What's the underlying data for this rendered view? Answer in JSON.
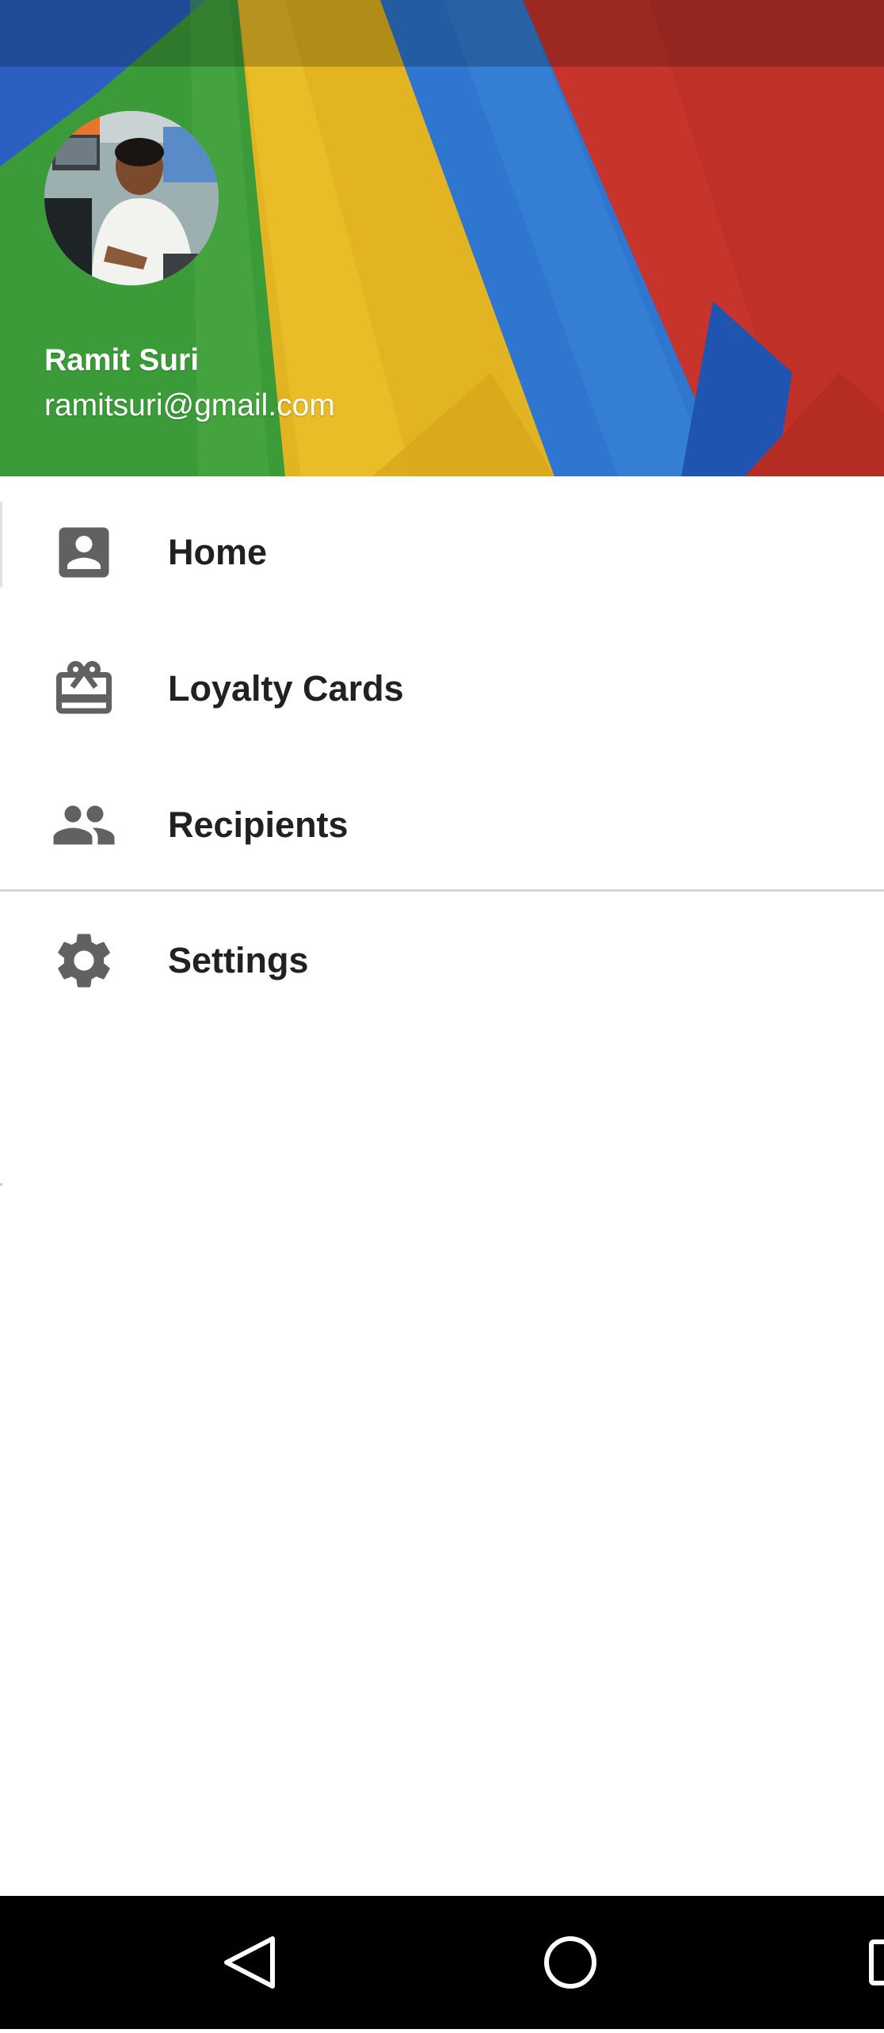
{
  "header": {
    "user_name": "Ramit Suri",
    "user_email": "ramitsuri@gmail.com",
    "wallpaper_colors": [
      "#2a5fc0",
      "#3d9a3a",
      "#e3b722",
      "#2f77d0",
      "#c8352c"
    ]
  },
  "menu": {
    "items": [
      {
        "label": "Home",
        "icon": "account-box-icon"
      },
      {
        "label": "Loyalty Cards",
        "icon": "card-giftcard-icon"
      },
      {
        "label": "Recipients",
        "icon": "people-icon"
      }
    ],
    "secondary_items": [
      {
        "label": "Settings",
        "icon": "gear-icon"
      }
    ],
    "icon_color": "#616161",
    "text_color": "#212121"
  },
  "navbar": {
    "buttons": [
      "back-icon",
      "home-icon",
      "recents-icon"
    ]
  }
}
